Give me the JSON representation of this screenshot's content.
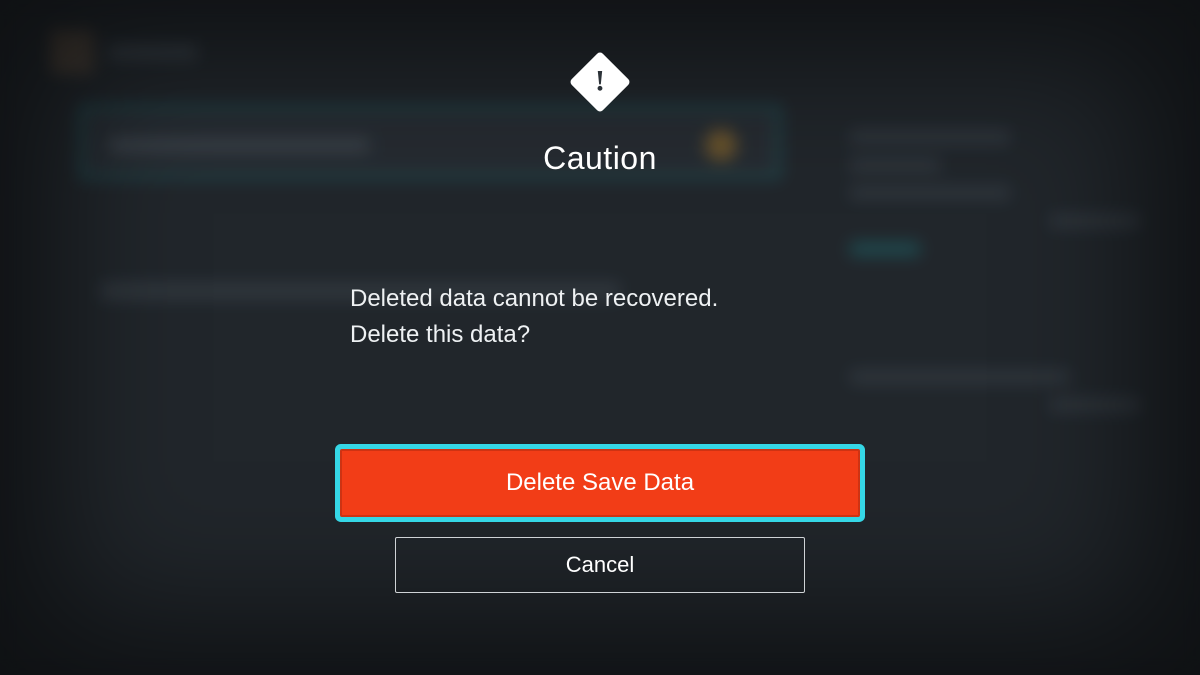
{
  "dialog": {
    "title": "Caution",
    "message_line1": "Deleted data cannot be recovered.",
    "message_line2": "Delete this data?",
    "primary_label": "Delete Save Data",
    "secondary_label": "Cancel"
  },
  "colors": {
    "danger": "#f23d17",
    "focus_ring": "#35d7e6",
    "background": "#2c3238"
  }
}
